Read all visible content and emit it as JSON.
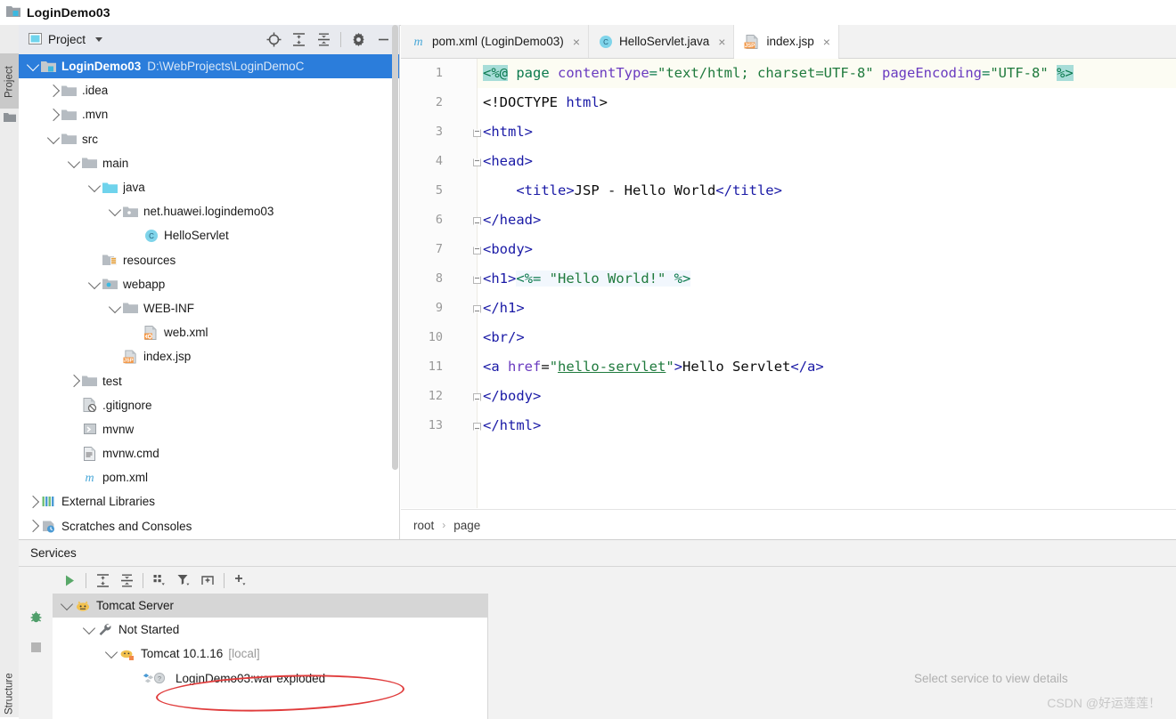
{
  "window": {
    "title": "LoginDemo03",
    "icon": "project-folder-icon"
  },
  "left_tool_tabs": [
    {
      "label": "Project",
      "active": true
    },
    {
      "label": "Structure",
      "active": false
    }
  ],
  "project_panel": {
    "header": {
      "title": "Project",
      "selector_icon": "project-view-icon",
      "dropdown_icon": "chevron-down-icon"
    },
    "toolbar": [
      {
        "name": "locate-icon",
        "title": "Select Opened File"
      },
      {
        "name": "expand-all-icon",
        "title": "Expand All"
      },
      {
        "name": "collapse-all-icon",
        "title": "Collapse All"
      },
      {
        "name": "gear-icon",
        "title": "Options"
      },
      {
        "name": "minimize-icon",
        "title": "Hide"
      }
    ],
    "tree": [
      {
        "label": "LoginDemo03",
        "sub": "D:\\WebProjects\\LoginDemoC",
        "indent": 0,
        "arrow": "down",
        "icon": "module-icon",
        "selected": true
      },
      {
        "label": ".idea",
        "sub": "",
        "indent": 1,
        "arrow": "right",
        "icon": "folder-icon",
        "selected": false
      },
      {
        "label": ".mvn",
        "sub": "",
        "indent": 1,
        "arrow": "right",
        "icon": "folder-icon",
        "selected": false
      },
      {
        "label": "src",
        "sub": "",
        "indent": 1,
        "arrow": "down",
        "icon": "folder-icon",
        "selected": false
      },
      {
        "label": "main",
        "sub": "",
        "indent": 2,
        "arrow": "down",
        "icon": "folder-icon",
        "selected": false
      },
      {
        "label": "java",
        "sub": "",
        "indent": 3,
        "arrow": "down",
        "icon": "source-root-icon",
        "selected": false
      },
      {
        "label": "net.huawei.logindemo03",
        "sub": "",
        "indent": 4,
        "arrow": "down",
        "icon": "package-icon",
        "selected": false
      },
      {
        "label": "HelloServlet",
        "sub": "",
        "indent": 5,
        "arrow": "none",
        "icon": "java-class-icon",
        "selected": false
      },
      {
        "label": "resources",
        "sub": "",
        "indent": 3,
        "arrow": "none",
        "icon": "resources-root-icon",
        "selected": false
      },
      {
        "label": "webapp",
        "sub": "",
        "indent": 3,
        "arrow": "down",
        "icon": "web-root-icon",
        "selected": false
      },
      {
        "label": "WEB-INF",
        "sub": "",
        "indent": 4,
        "arrow": "down",
        "icon": "folder-icon",
        "selected": false
      },
      {
        "label": "web.xml",
        "sub": "",
        "indent": 5,
        "arrow": "none",
        "icon": "xml-file-icon",
        "selected": false
      },
      {
        "label": "index.jsp",
        "sub": "",
        "indent": 4,
        "arrow": "none",
        "icon": "jsp-file-icon",
        "selected": false
      },
      {
        "label": "test",
        "sub": "",
        "indent": 2,
        "arrow": "right",
        "icon": "folder-icon",
        "selected": false
      },
      {
        "label": ".gitignore",
        "sub": "",
        "indent": 2,
        "arrow": "none",
        "icon": "gitignore-file-icon",
        "selected": false
      },
      {
        "label": "mvnw",
        "sub": "",
        "indent": 2,
        "arrow": "none",
        "icon": "shell-script-icon",
        "selected": false
      },
      {
        "label": "mvnw.cmd",
        "sub": "",
        "indent": 2,
        "arrow": "none",
        "icon": "cmd-file-icon",
        "selected": false
      },
      {
        "label": "pom.xml",
        "sub": "",
        "indent": 2,
        "arrow": "none",
        "icon": "maven-file-icon",
        "selected": false
      },
      {
        "label": "External Libraries",
        "sub": "",
        "indent": 0,
        "arrow": "right",
        "icon": "libraries-icon",
        "selected": false
      },
      {
        "label": "Scratches and Consoles",
        "sub": "",
        "indent": 0,
        "arrow": "right",
        "icon": "scratches-icon",
        "selected": false
      }
    ]
  },
  "editor": {
    "tabs": [
      {
        "label": "pom.xml (LoginDemo03)",
        "icon": "maven-file-icon",
        "active": false,
        "close": "×"
      },
      {
        "label": "HelloServlet.java",
        "icon": "java-class-icon",
        "active": false,
        "close": "×"
      },
      {
        "label": "index.jsp",
        "icon": "jsp-file-icon",
        "active": true,
        "close": "×"
      }
    ],
    "line_numbers": [
      "1",
      "2",
      "3",
      "4",
      "5",
      "6",
      "7",
      "8",
      "9",
      "10",
      "11",
      "12",
      "13"
    ],
    "code": [
      "<%@ page contentType=\"text/html; charset=UTF-8\" pageEncoding=\"UTF-8\" %>",
      "<!DOCTYPE html>",
      "<html>",
      "<head>",
      "    <title>JSP - Hello World</title>",
      "</head>",
      "<body>",
      "<h1><%= \"Hello World!\" %>",
      "</h1>",
      "<br/>",
      "<a href=\"hello-servlet\">Hello Servlet</a>",
      "</body>",
      "</html>"
    ],
    "breadcrumb": [
      "root",
      "page"
    ],
    "breadcrumb_separator": "›"
  },
  "services": {
    "title": "Services",
    "toolbar": [
      {
        "name": "run-icon",
        "title": "Run"
      },
      {
        "name": "expand-all-icon",
        "title": "Expand All"
      },
      {
        "name": "collapse-all-icon",
        "title": "Collapse All"
      },
      {
        "name": "group-by-icon",
        "title": "Group By"
      },
      {
        "name": "filter-icon",
        "title": "Filter"
      },
      {
        "name": "show-tabs-icon",
        "title": "Show Tabs"
      },
      {
        "name": "add-icon",
        "title": "Add Service"
      }
    ],
    "side_icons": [
      {
        "name": "debug-bug-icon"
      },
      {
        "name": "stop-icon"
      }
    ],
    "tree": [
      {
        "label": "Tomcat Server",
        "dim": "",
        "indent": 0,
        "arrow": "down",
        "icon": "tomcat-icon",
        "highlight": true
      },
      {
        "label": "Not Started",
        "dim": "",
        "indent": 1,
        "arrow": "down",
        "icon": "wrench-icon",
        "highlight": false
      },
      {
        "label": "Tomcat 10.1.16",
        "dim": "[local]",
        "indent": 2,
        "arrow": "down",
        "icon": "tomcat-run-icon",
        "highlight": false
      },
      {
        "label": "LoginDemo03:war exploded",
        "dim": "",
        "indent": 3,
        "arrow": "none",
        "icon": "artifact-icon",
        "highlight": false
      }
    ],
    "empty_message": "Select service to view details"
  },
  "watermark": "CSDN @好运莲莲！",
  "colors": {
    "selection_blue": "#2b7ddb",
    "tag_blue": "#1a1aa6",
    "attr_purple": "#6a3bc0",
    "string_green": "#1f7a3d",
    "jsp_scriptlet_bg": "#a7ddd8",
    "annotation_red": "#e03c3c"
  }
}
